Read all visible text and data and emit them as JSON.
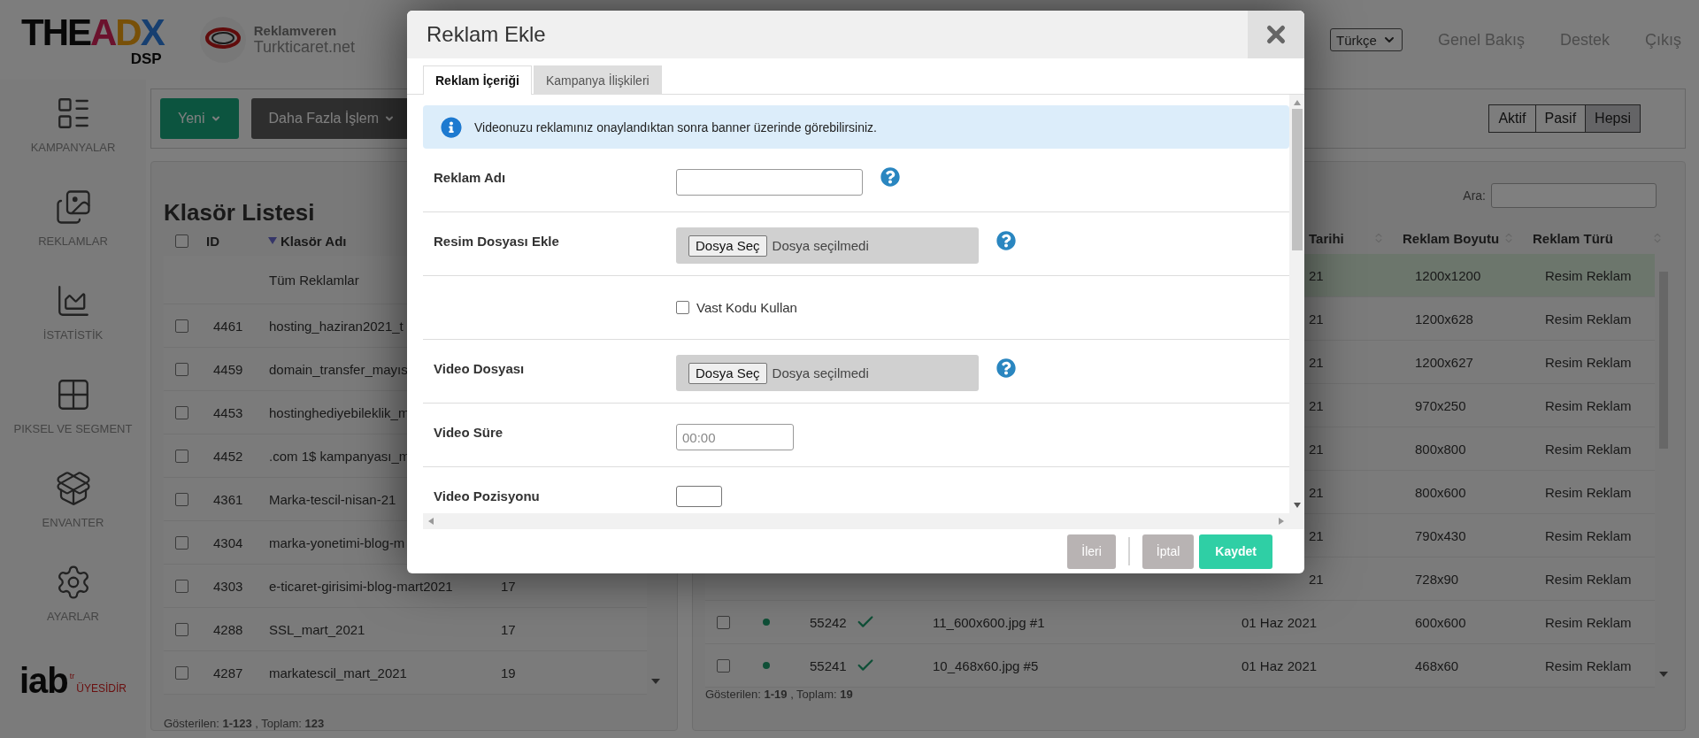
{
  "header": {
    "logo": {
      "parts": [
        "THE",
        "A",
        "D",
        "X"
      ],
      "sub": "DSP"
    },
    "advertiser_label": "Reklamveren",
    "advertiser_name": "Turkticaret.net",
    "language": "Türkçe",
    "nav": [
      "Genel Bakış",
      "Destek",
      "Çıkış"
    ]
  },
  "sidebar": {
    "items": [
      {
        "kind": "campaigns",
        "label": "KAMPANYALAR"
      },
      {
        "kind": "ads",
        "label": "REKLAMLAR"
      },
      {
        "kind": "stats",
        "label": "İSTATİSTİK"
      },
      {
        "kind": "pixel",
        "label": "PIKSEL VE SEGMENT"
      },
      {
        "kind": "inventory",
        "label": "ENVANTER"
      },
      {
        "kind": "settings",
        "label": "AYARLAR"
      }
    ],
    "member_badge": {
      "logo": "iab",
      "country": "tr",
      "text": "ÜYESİDİR"
    }
  },
  "toolbar": {
    "buttons": [
      {
        "kind": "primary",
        "label": "Yeni"
      },
      {
        "kind": "dark",
        "label": "Daha Fazla İşlem"
      }
    ],
    "filters": [
      {
        "label": "Aktif",
        "selected": false
      },
      {
        "label": "Pasif",
        "selected": false
      },
      {
        "label": "Hepsi",
        "selected": true
      }
    ]
  },
  "folders": {
    "title": "Klasör Listesi",
    "all_checked": false,
    "columns": [
      "ID",
      "Klasör Adı"
    ],
    "all_row": "Tüm Reklamlar",
    "rows": [
      {
        "id": "4461",
        "name": "hosting_haziran2021_t",
        "checked": false
      },
      {
        "id": "4459",
        "name": "domain_transfer_mayıs",
        "checked": false
      },
      {
        "id": "4453",
        "name": "hostinghediyebileklik_m",
        "checked": false
      },
      {
        "id": "4452",
        "name": ".com 1$ kampanyası_m",
        "checked": false
      },
      {
        "id": "4361",
        "name": "Marka-tescil-nisan-21",
        "checked": false
      },
      {
        "id": "4304",
        "name": "marka-yonetimi-blog-m",
        "checked": false
      },
      {
        "id": "4303",
        "name": "e-ticaret-girisimi-blog-mart2021",
        "count": "17",
        "checked": false
      },
      {
        "id": "4288",
        "name": "SSL_mart_2021",
        "count": "17",
        "checked": false
      },
      {
        "id": "4287",
        "name": "markatescil_mart_2021",
        "count": "19",
        "checked": false
      }
    ],
    "footer": "Gösterilen: **1-123** , Toplam: **123**"
  },
  "ads": {
    "search_label": "Ara:",
    "columns": [
      "Tarihi",
      "Reklam Boyutu",
      "Reklam Türü"
    ],
    "rows": [
      {
        "date": "21",
        "size": "1200x1200",
        "type": "Resim Reklam",
        "selected": true
      },
      {
        "date": "21",
        "size": "1200x628",
        "type": "Resim Reklam",
        "selected": false
      },
      {
        "date": "21",
        "size": "1200x627",
        "type": "Resim Reklam",
        "selected": false
      },
      {
        "date": "21",
        "size": "970x250",
        "type": "Resim Reklam",
        "selected": false
      },
      {
        "date": "21",
        "size": "800x800",
        "type": "Resim Reklam",
        "selected": false
      },
      {
        "date": "21",
        "size": "800x600",
        "type": "Resim Reklam",
        "selected": false
      },
      {
        "date": "21",
        "size": "790x430",
        "type": "Resim Reklam",
        "selected": false
      },
      {
        "date": "21",
        "size": "728x90",
        "type": "Resim Reklam",
        "selected": false
      },
      {
        "id": "55242",
        "checked": false,
        "active": true,
        "approved": true,
        "name": "11_600x600.jpg #1",
        "date": "01 Haz 2021",
        "size": "600x600",
        "type": "Resim Reklam",
        "selected": false
      },
      {
        "id": "55241",
        "checked": false,
        "active": true,
        "approved": true,
        "name": "10_468x60.jpg #5",
        "date": "01 Haz 2021",
        "size": "468x60",
        "type": "Resim Reklam",
        "selected": false
      }
    ],
    "footer": "Gösterilen: **1-19** , Toplam: **19**"
  },
  "modal": {
    "title": "Reklam Ekle",
    "tabs": [
      {
        "label": "Reklam İçeriği",
        "selected": true
      },
      {
        "label": "Kampanya İlişkileri",
        "selected": false
      }
    ],
    "notice": "Videonuzu reklamınız onaylandıktan sonra banner üzerinde görebilirsiniz.",
    "fields": [
      {
        "kind": "text",
        "label": "Reklam Adı",
        "help": true
      },
      {
        "kind": "file",
        "label": "Resim Dosyası Ekle",
        "button": "Dosya Seç",
        "value": "Dosya seçilmedi",
        "help": true
      },
      {
        "kind": "checkbox",
        "option": "Vast Kodu Kullan",
        "checked": false
      },
      {
        "kind": "file",
        "label": "Video Dosyası",
        "button": "Dosya Seç",
        "value": "Dosya seçilmedi",
        "help": true
      },
      {
        "kind": "text",
        "label": "Video Süre",
        "placeholder": "00:00",
        "help": false
      },
      {
        "kind": "select",
        "label": "Video Pozisyonu"
      }
    ],
    "buttons": [
      {
        "kind": "step",
        "label": "İleri"
      },
      {
        "kind": "secondary",
        "label": "İptal"
      },
      {
        "kind": "primary",
        "label": "Kaydet"
      }
    ]
  }
}
